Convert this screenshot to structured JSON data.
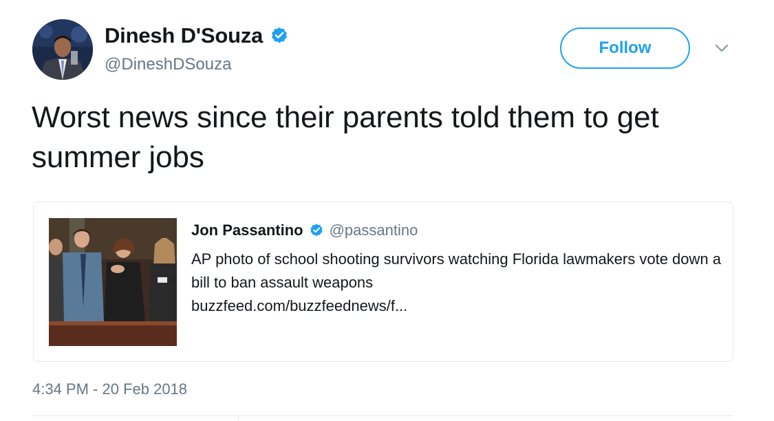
{
  "author": {
    "name": "Dinesh D'Souza",
    "handle": "@DineshDSouza",
    "verified": true
  },
  "follow_button": {
    "label": "Follow"
  },
  "icons": {
    "avatar": "avatar",
    "verified": "verified-badge-icon",
    "caret": "chevron-down-icon"
  },
  "tweet": {
    "text": "Worst news since their parents told them to get summer jobs",
    "timestamp": "4:34 PM - 20 Feb 2018"
  },
  "quoted_tweet": {
    "name": "Jon Passantino",
    "handle": "@passantino",
    "verified": true,
    "text": "AP photo of school shooting survivors watching Florida lawmakers vote down a bill to ban assault weapons",
    "link": "buzzfeed.com/buzzfeednews/f..."
  },
  "colors": {
    "accent": "#1da1f2",
    "text": "#14171a",
    "secondary_text": "#657786",
    "border": "#e1e8ed"
  }
}
